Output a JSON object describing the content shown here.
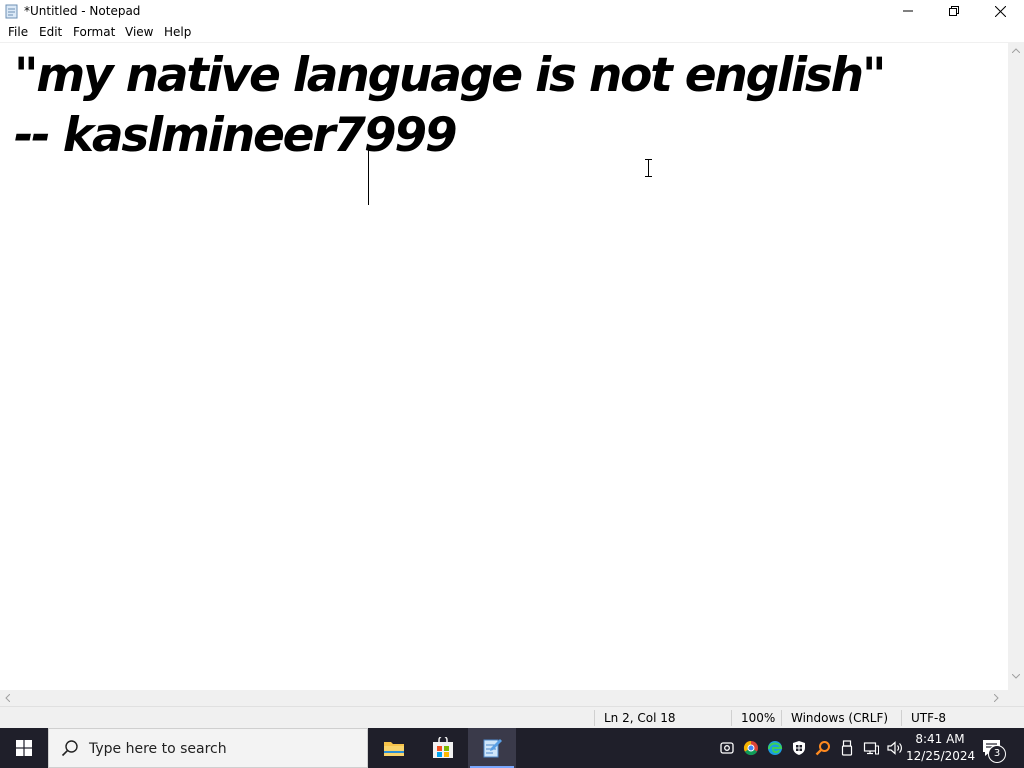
{
  "window": {
    "title": "*Untitled - Notepad",
    "icon": "notepad-icon"
  },
  "menu": {
    "items": [
      "File",
      "Edit",
      "Format",
      "View",
      "Help"
    ]
  },
  "editor": {
    "lines": [
      "\"my native language is not english\"",
      "-- kaslmineer7999"
    ]
  },
  "status": {
    "position": "Ln 2, Col 18",
    "zoom": "100%",
    "line_ending": "Windows (CRLF)",
    "encoding": "UTF-8"
  },
  "taskbar": {
    "search_placeholder": "Type here to search",
    "time": "8:41 AM",
    "date": "12/25/2024",
    "notification_count": "3",
    "pinned": [
      "file-explorer-icon",
      "microsoft-store-icon",
      "notepad-icon"
    ],
    "tray": [
      "security-icon",
      "chrome-icon",
      "edge-icon",
      "windows-defender-icon",
      "search-app-icon",
      "usb-icon",
      "network-icon",
      "volume-icon"
    ]
  },
  "colors": {
    "taskbar_bg": "#1f1f2a",
    "accent": "#7aa7ff"
  }
}
